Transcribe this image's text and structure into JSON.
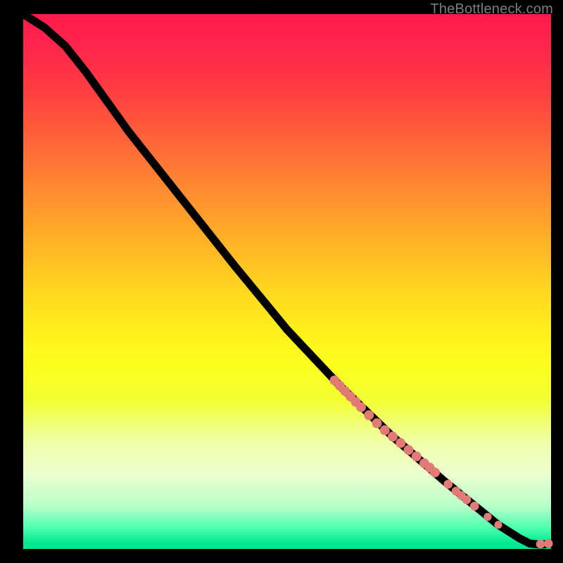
{
  "attribution": "TheBottleneck.com",
  "colors": {
    "page_bg": "#000000",
    "gradient_top": "#ff1a4d",
    "gradient_mid": "#fff21c",
    "gradient_bottom": "#00e890",
    "curve": "#000000",
    "point": "#e27a78",
    "attribution_text": "#7d7d7d"
  },
  "chart_data": {
    "type": "line",
    "title": "",
    "xlabel": "",
    "ylabel": "",
    "xlim": [
      0,
      100
    ],
    "ylim": [
      0,
      100
    ],
    "curve": [
      {
        "x": 0,
        "y": 100
      },
      {
        "x": 4,
        "y": 97.5
      },
      {
        "x": 8,
        "y": 94
      },
      {
        "x": 12,
        "y": 89
      },
      {
        "x": 20,
        "y": 78
      },
      {
        "x": 30,
        "y": 65.5
      },
      {
        "x": 40,
        "y": 53
      },
      {
        "x": 50,
        "y": 41
      },
      {
        "x": 60,
        "y": 30.5
      },
      {
        "x": 70,
        "y": 21
      },
      {
        "x": 80,
        "y": 12.5
      },
      {
        "x": 90,
        "y": 4.5
      },
      {
        "x": 94,
        "y": 2
      },
      {
        "x": 96,
        "y": 1
      },
      {
        "x": 98,
        "y": 0.8
      },
      {
        "x": 100,
        "y": 1
      }
    ],
    "points": [
      {
        "x": 59,
        "y": 31.5,
        "r": 1.0
      },
      {
        "x": 60,
        "y": 30.5,
        "r": 1.0
      },
      {
        "x": 61,
        "y": 29.5,
        "r": 1.0
      },
      {
        "x": 62,
        "y": 28.5,
        "r": 1.0
      },
      {
        "x": 63,
        "y": 27.5,
        "r": 1.0
      },
      {
        "x": 64,
        "y": 26.5,
        "r": 1.0
      },
      {
        "x": 65.5,
        "y": 25.0,
        "r": 1.0
      },
      {
        "x": 67,
        "y": 23.5,
        "r": 1.0
      },
      {
        "x": 68.5,
        "y": 22.2,
        "r": 1.0
      },
      {
        "x": 70,
        "y": 21.0,
        "r": 1.0
      },
      {
        "x": 71.5,
        "y": 19.8,
        "r": 1.0
      },
      {
        "x": 73,
        "y": 18.5,
        "r": 1.0
      },
      {
        "x": 74.5,
        "y": 17.3,
        "r": 1.0
      },
      {
        "x": 76,
        "y": 16.0,
        "r": 1.0
      },
      {
        "x": 77,
        "y": 15.2,
        "r": 1.0
      },
      {
        "x": 78,
        "y": 14.3,
        "r": 1.0
      },
      {
        "x": 80.5,
        "y": 12.1,
        "r": 0.9
      },
      {
        "x": 82,
        "y": 10.8,
        "r": 0.9
      },
      {
        "x": 83,
        "y": 10.0,
        "r": 0.9
      },
      {
        "x": 84,
        "y": 9.2,
        "r": 0.9
      },
      {
        "x": 85.5,
        "y": 8.0,
        "r": 0.9
      },
      {
        "x": 88,
        "y": 6.0,
        "r": 0.8
      },
      {
        "x": 90,
        "y": 4.5,
        "r": 0.8
      },
      {
        "x": 98,
        "y": 0.9,
        "r": 0.9
      },
      {
        "x": 99.5,
        "y": 1.0,
        "r": 0.9
      }
    ]
  }
}
